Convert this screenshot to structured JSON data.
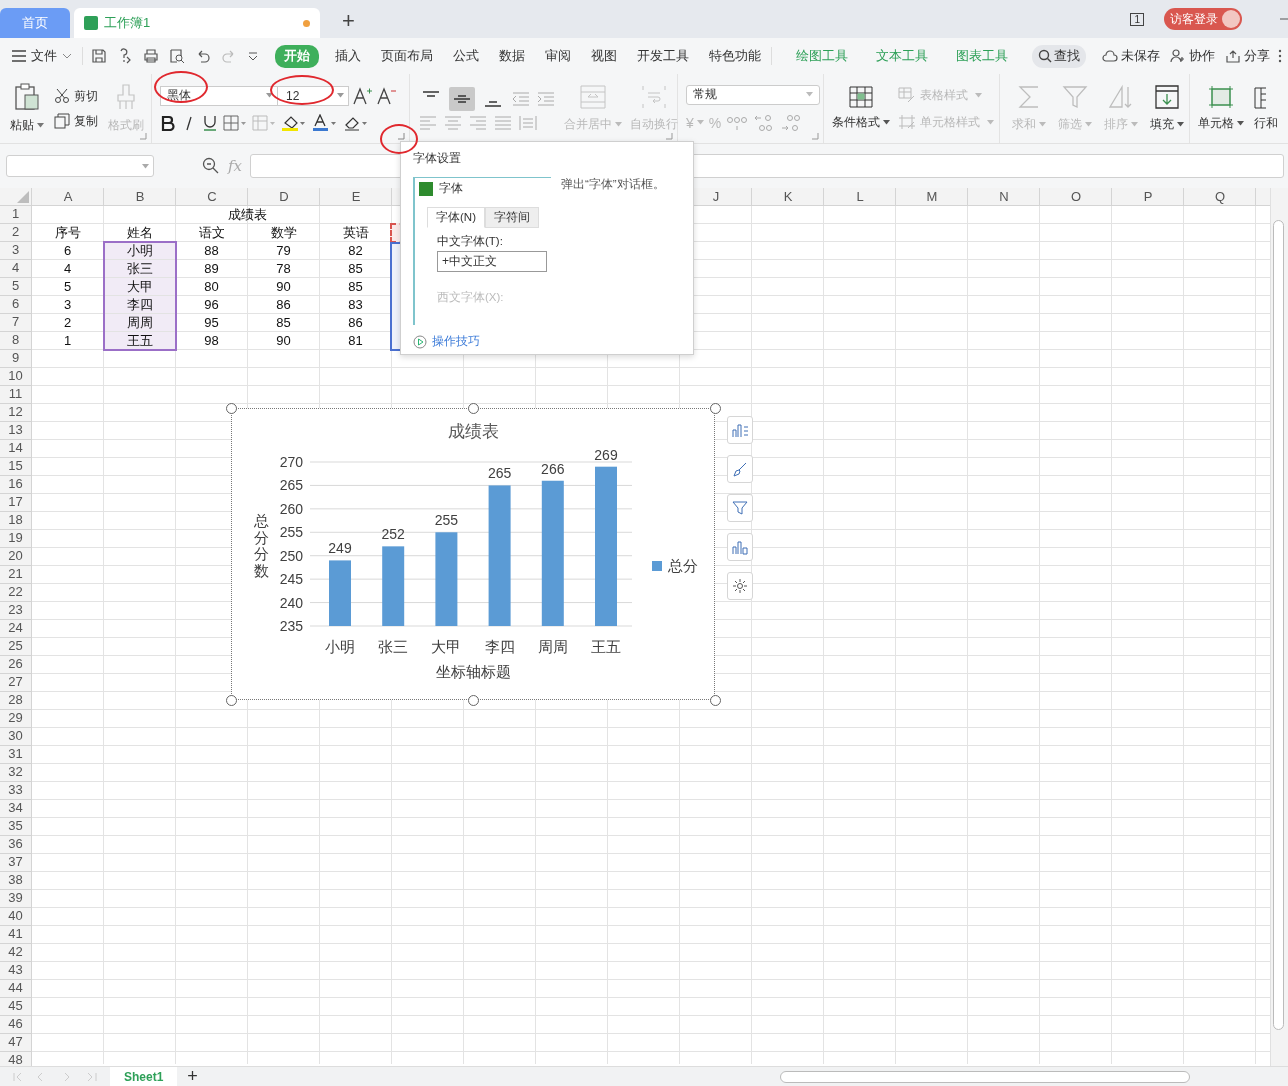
{
  "tabs": [
    {
      "label": "首页",
      "kind": "home",
      "selected": false
    },
    {
      "label": "工作簿1",
      "kind": "doc",
      "selected": true,
      "unsaved": true
    }
  ],
  "new_tab": "+",
  "page_indicator": "1",
  "login": "访客登录",
  "menu": {
    "file": "文件",
    "items": [
      {
        "label": "开始",
        "selected": true
      },
      {
        "label": "插入",
        "selected": false
      },
      {
        "label": "页面布局",
        "selected": false
      },
      {
        "label": "公式",
        "selected": false
      },
      {
        "label": "数据",
        "selected": false
      },
      {
        "label": "审阅",
        "selected": false
      },
      {
        "label": "视图",
        "selected": false
      },
      {
        "label": "开发工具",
        "selected": false
      },
      {
        "label": "特色功能",
        "selected": false
      }
    ],
    "context_tools": [
      "绘图工具",
      "文本工具",
      "图表工具"
    ],
    "search": "查找",
    "actions": [
      "未保存",
      "协作",
      "分享"
    ]
  },
  "ribbon": {
    "paste": "粘贴",
    "cut": "剪切",
    "copy": "复制",
    "format_painter": {
      "label": "格式刷",
      "disabled": true
    },
    "font_name": "黑体",
    "font_size": "12",
    "vertical_align": [
      {
        "selected": false
      },
      {
        "selected": true
      },
      {
        "selected": false
      }
    ],
    "merge": {
      "label": "合并居中",
      "disabled": true
    },
    "wrap": {
      "label": "自动换行",
      "disabled": true
    },
    "number_format": "常规",
    "currency": "¥",
    "percent": "%",
    "conditional_format": "条件格式",
    "table_style": {
      "label": "表格样式",
      "disabled": true
    },
    "cell_style": {
      "label": "单元格样式",
      "disabled": true
    },
    "sum": {
      "label": "求和",
      "disabled": true
    },
    "filter": {
      "label": "筛选",
      "disabled": true
    },
    "sort": {
      "label": "排序",
      "disabled": true
    },
    "fill": {
      "label": "填充",
      "disabled": false
    },
    "cell": "单元格",
    "row_col": "行和"
  },
  "formula_bar": {
    "fx": "fx"
  },
  "column_headers_left": [
    "A",
    "B",
    "C",
    "D",
    "E"
  ],
  "column_headers_right": [
    "J",
    "K",
    "L",
    "M",
    "N",
    "O",
    "P",
    "Q"
  ],
  "row_numbers": [
    "1",
    "2",
    "3",
    "4",
    "5",
    "6",
    "7",
    "8",
    "9",
    "10",
    "11",
    "12",
    "13",
    "14",
    "15",
    "16",
    "17",
    "18",
    "19",
    "20",
    "21",
    "22",
    "23",
    "24",
    "25",
    "26",
    "27",
    "28",
    "29",
    "30",
    "31",
    "32",
    "33",
    "34",
    "35",
    "36",
    "37",
    "38",
    "39",
    "40",
    "41",
    "42",
    "43",
    "44",
    "45",
    "46",
    "47",
    "48"
  ],
  "table": {
    "title": "成绩表",
    "header": [
      "序号",
      "姓名",
      "语文",
      "数学",
      "英语"
    ],
    "rows": [
      [
        "6",
        "小明",
        "88",
        "79",
        "82"
      ],
      [
        "4",
        "张三",
        "89",
        "78",
        "85"
      ],
      [
        "5",
        "大甲",
        "80",
        "90",
        "85"
      ],
      [
        "3",
        "李四",
        "96",
        "86",
        "83"
      ],
      [
        "2",
        "周周",
        "95",
        "85",
        "86"
      ],
      [
        "1",
        "王五",
        "98",
        "90",
        "81"
      ]
    ]
  },
  "chart": {
    "chart_data": {
      "type": "bar",
      "title": "成绩表",
      "xlabel": "坐标轴标题",
      "ylabel": "总分分数",
      "categories": [
        "小明",
        "张三",
        "大甲",
        "李四",
        "周周",
        "王五"
      ],
      "series": [
        {
          "name": "总分",
          "color": "#5b9bd5",
          "values": [
            249,
            252,
            255,
            265,
            266,
            269
          ]
        }
      ],
      "ylim": [
        235,
        270
      ],
      "yticks": [
        235,
        240,
        245,
        250,
        255,
        260,
        265,
        270
      ],
      "grid": true,
      "data_labels": true
    }
  },
  "tooltip": {
    "title": "字体设置",
    "dialog_title": "字体",
    "dialog_tabs": [
      {
        "label": "字体(N)",
        "selected": true
      },
      {
        "label": "字符间",
        "selected": false
      }
    ],
    "chinese_font_label": "中文字体(T):",
    "chinese_font_value": "+中文正文",
    "western_font_label": "西文字体(X):",
    "description": "弹出“字体”对话框。",
    "link": "操作技巧"
  },
  "sheets": [
    {
      "name": "Sheet1",
      "selected": true
    }
  ],
  "add_sheet": "+"
}
